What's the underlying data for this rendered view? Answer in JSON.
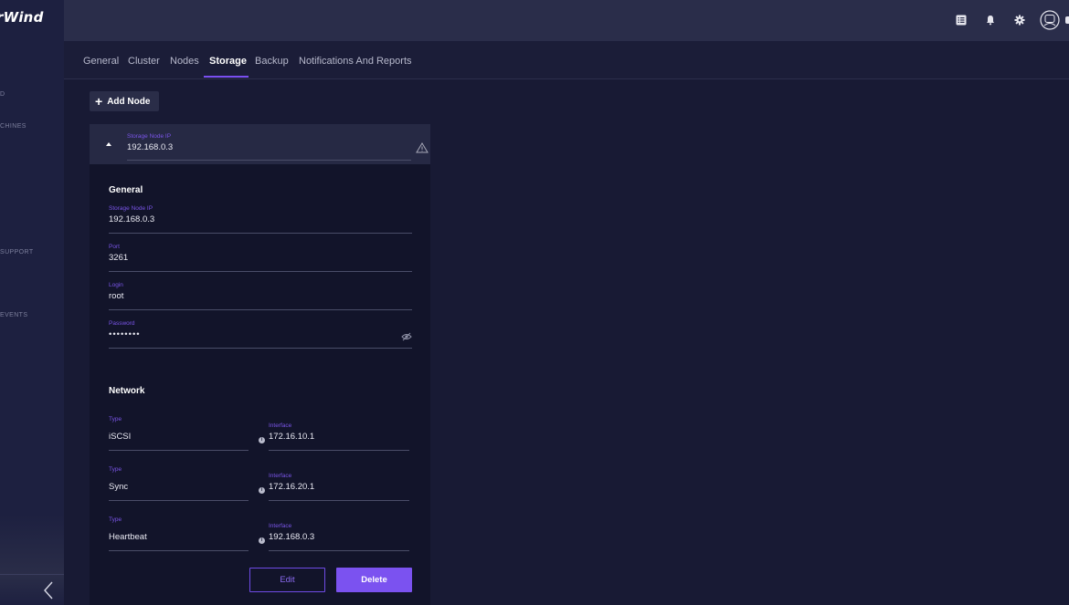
{
  "sidebar": {
    "brand": "rWind",
    "items": [
      {
        "label": "D"
      },
      {
        "label": "CHINES"
      },
      {
        "label": "SUPPORT"
      },
      {
        "label": "EVENTS"
      }
    ]
  },
  "topbar": {
    "icons": [
      "list-icon",
      "bell-icon",
      "gear-icon",
      "avatar-icon"
    ]
  },
  "tabs": [
    {
      "label": "General"
    },
    {
      "label": "Cluster"
    },
    {
      "label": "Nodes"
    },
    {
      "label": "Storage"
    },
    {
      "label": "Backup"
    },
    {
      "label": "Notifications And Reports"
    }
  ],
  "add_node_label": "Add Node",
  "node": {
    "header_label": "Storage Node IP",
    "header_value": "192.168.0.3",
    "general_title": "General",
    "fields": {
      "ip": {
        "label": "Storage Node IP",
        "value": "192.168.0.3"
      },
      "port": {
        "label": "Port",
        "value": "3261"
      },
      "login": {
        "label": "Login",
        "value": "root"
      },
      "password": {
        "label": "Password",
        "value": "••••••••"
      }
    },
    "network_title": "Network",
    "network": [
      {
        "type_label": "Type",
        "type": "iSCSI",
        "iface_label": "Interface",
        "iface": "172.16.10.1"
      },
      {
        "type_label": "Type",
        "type": "Sync",
        "iface_label": "Interface",
        "iface": "172.16.20.1"
      },
      {
        "type_label": "Type",
        "type": "Heartbeat",
        "iface_label": "Interface",
        "iface": "192.168.0.3"
      }
    ],
    "edit_label": "Edit",
    "delete_label": "Delete"
  }
}
